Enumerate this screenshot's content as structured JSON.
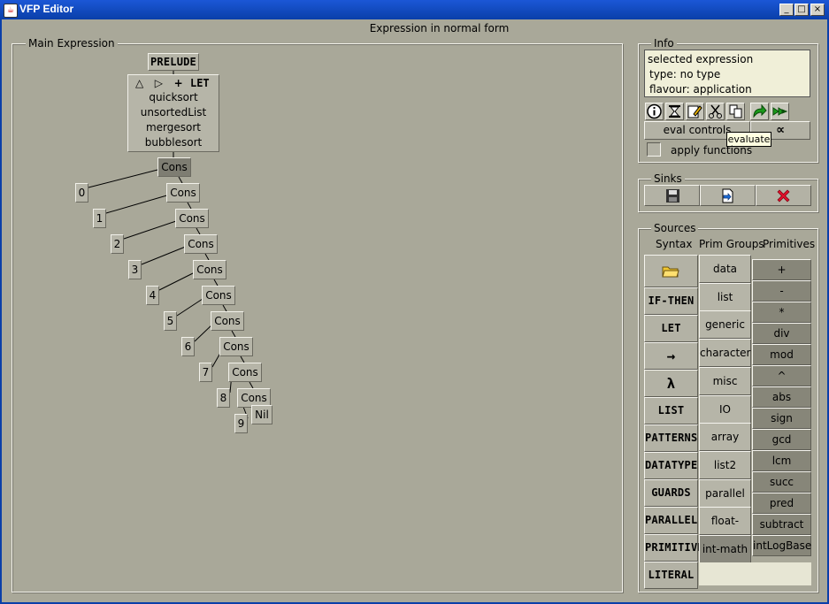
{
  "window": {
    "title": "VFP Editor",
    "minimize": "_",
    "maximize": "□",
    "close": "×"
  },
  "heading": "Expression in normal form",
  "main": {
    "legend": "Main Expression",
    "prelude": "PRELUDE",
    "let_header": {
      "up": "△",
      "right": "▷",
      "plus": "+",
      "let": "LET"
    },
    "bindings": [
      "quicksort",
      "unsortedList",
      "mergesort",
      "bubblesort"
    ],
    "cons_label": "Cons",
    "nil_label": "Nil",
    "numbers": [
      "0",
      "1",
      "2",
      "3",
      "4",
      "5",
      "6",
      "7",
      "8",
      "9"
    ]
  },
  "info": {
    "legend": "Info",
    "line1": "selected expression",
    "line2": "type: no type",
    "line3": "flavour: application",
    "eval_controls": "eval controls",
    "alpha": "∝",
    "apply_functions": "apply functions",
    "tooltip": "evaluate"
  },
  "sinks": {
    "legend": "Sinks"
  },
  "sources": {
    "legend": "Sources",
    "col_syntax": "Syntax",
    "col_prim_groups": "Prim Groups",
    "col_primitives": "Primitives",
    "syntax": [
      "IF-THEN",
      "LET",
      "→",
      "λ",
      "LIST",
      "PATTERNS",
      "DATATYPE",
      "GUARDS",
      "PARALLEL",
      "PRIMITIVE",
      "LITERAL"
    ],
    "prim_groups": [
      "data",
      "list",
      "generic",
      "character",
      "misc",
      "IO",
      "array",
      "list2",
      "parallel",
      "float-math",
      "int-math"
    ],
    "primitives": [
      "+",
      "-",
      "*",
      "div",
      "mod",
      "^",
      "abs",
      "sign",
      "gcd",
      "lcm",
      "succ",
      "pred",
      "subtract",
      "intLogBase"
    ]
  }
}
